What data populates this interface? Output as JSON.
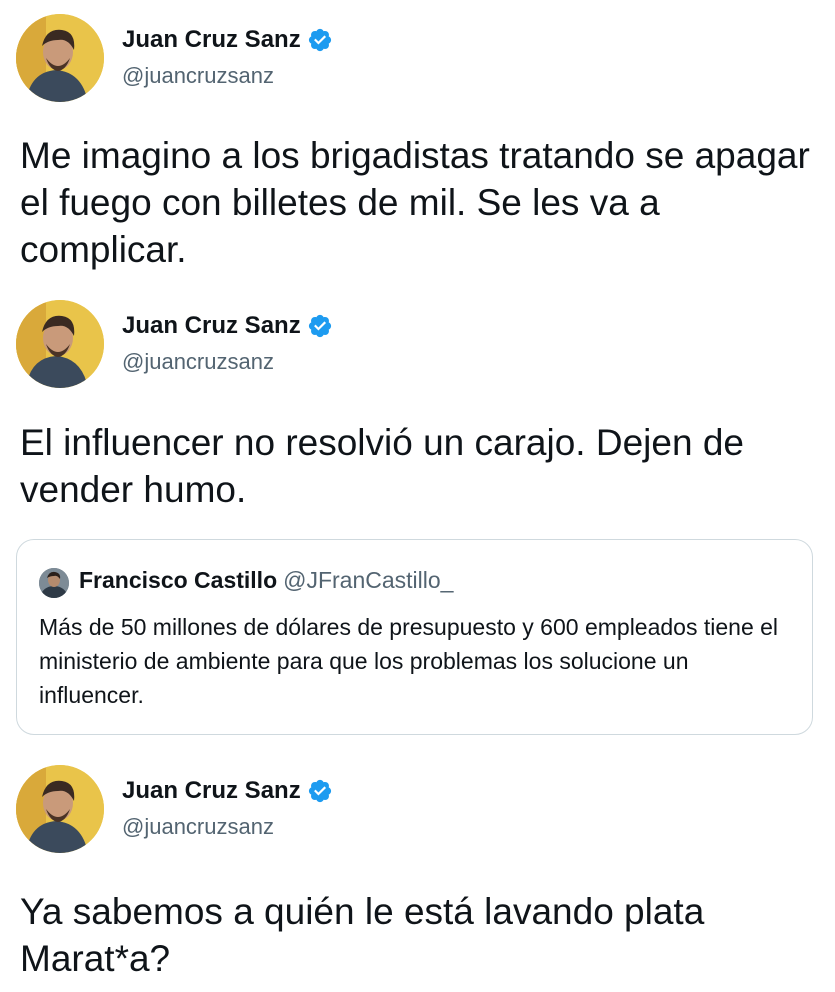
{
  "tweets": [
    {
      "author": {
        "name": "Juan Cruz Sanz",
        "handle": "@juancruzsanz",
        "avatar_icon": "profile-photo",
        "verified_icon": "verified-badge-icon"
      },
      "text": "Me imagino a los brigadistas tratando se apagar el fuego con billetes de mil. Se les va a complicar."
    },
    {
      "author": {
        "name": "Juan Cruz Sanz",
        "handle": "@juancruzsanz",
        "avatar_icon": "profile-photo",
        "verified_icon": "verified-badge-icon"
      },
      "text": "El influencer no resolvió un carajo. Dejen de vender humo.",
      "quote": {
        "author": {
          "name": "Francisco Castillo",
          "handle": "@JFranCastillo_",
          "avatar_icon": "profile-photo"
        },
        "text": "Más de 50 millones de dólares de presupuesto y 600 empleados tiene el ministerio de ambiente para que los problemas los solucione un influencer."
      }
    },
    {
      "author": {
        "name": "Juan Cruz Sanz",
        "handle": "@juancruzsanz",
        "avatar_icon": "profile-photo",
        "verified_icon": "verified-badge-icon"
      },
      "text": "Ya sabemos a quién le está lavando plata Marat*a?"
    }
  ],
  "colors": {
    "text": "#0f1419",
    "secondary": "#536471",
    "verified": "#1d9bf0",
    "border": "#cfd9de",
    "avatar_bg": "#e9c44a"
  }
}
